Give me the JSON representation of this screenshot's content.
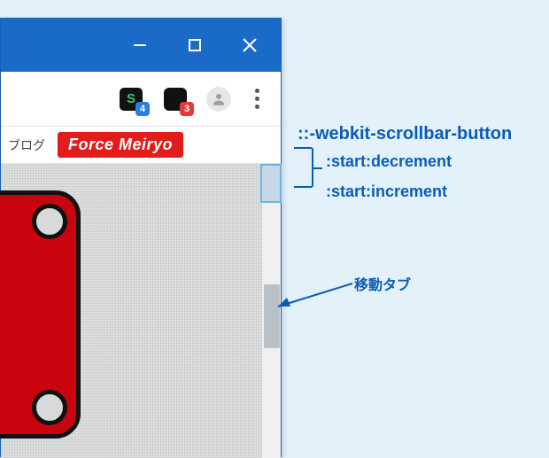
{
  "window": {
    "controls": {
      "minimize": "minimize",
      "maximize": "maximize",
      "close": "close"
    }
  },
  "toolbar": {
    "ext1": {
      "letter": "S",
      "badge": "4"
    },
    "ext2": {
      "badge": "3"
    },
    "avatar": "user",
    "menu": "more"
  },
  "bookmarks": {
    "item1": "ブログ",
    "item2": "Force Meiryo"
  },
  "annotations": {
    "selector": "::-webkit-scrollbar-button",
    "line1": ":start:decrement",
    "line2": ":start:increment",
    "thumb_label": "移動タブ"
  }
}
